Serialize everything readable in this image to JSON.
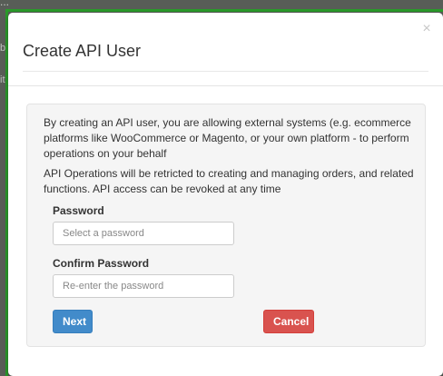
{
  "background": {
    "top_text": "...",
    "side_text_1": "b",
    "side_text_2": "it"
  },
  "modal": {
    "title": "Create API User",
    "close_glyph": "×",
    "description_1": "By creating an API user, you are allowing external systems (e.g. ecommerce platforms like WooCommerce or Magento, or your own platform - to perform operations on your behalf",
    "description_2": "API Operations will be retricted to creating and managing orders, and related functions. API access can be revoked at any time",
    "password": {
      "label": "Password",
      "placeholder": "Select a password",
      "value": ""
    },
    "confirm_password": {
      "label": "Confirm Password",
      "placeholder": "Re-enter the password",
      "value": ""
    },
    "next_label": "Next",
    "cancel_label": "Cancel"
  },
  "colors": {
    "primary": "#428bca",
    "danger": "#d9534f",
    "frame_green": "#2a9b2a"
  }
}
